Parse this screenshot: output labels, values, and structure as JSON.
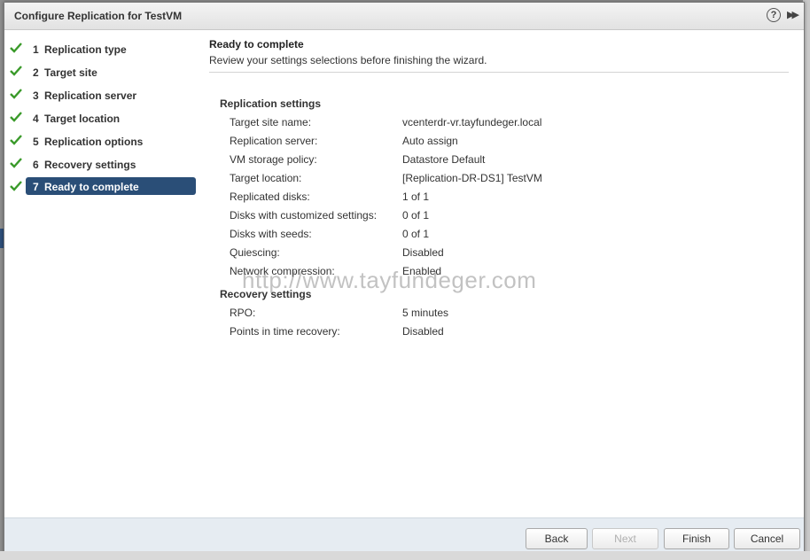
{
  "window": {
    "title": "Configure Replication for TestVM"
  },
  "steps": [
    {
      "num": "1",
      "label": "Replication type",
      "done": true
    },
    {
      "num": "2",
      "label": "Target site",
      "done": true
    },
    {
      "num": "3",
      "label": "Replication server",
      "done": true
    },
    {
      "num": "4",
      "label": "Target location",
      "done": true
    },
    {
      "num": "5",
      "label": "Replication options",
      "done": true
    },
    {
      "num": "6",
      "label": "Recovery settings",
      "done": true
    },
    {
      "num": "7",
      "label": "Ready to complete",
      "done": true,
      "active": true
    }
  ],
  "content": {
    "title": "Ready to complete",
    "subtitle": "Review your settings selections before finishing the wizard.",
    "replication_title": "Replication settings",
    "replication": [
      {
        "label": "Target site name:",
        "value": "vcenterdr-vr.tayfundeger.local"
      },
      {
        "label": "Replication server:",
        "value": "Auto assign"
      },
      {
        "label": "VM storage policy:",
        "value": "Datastore Default"
      },
      {
        "label": "Target location:",
        "value": "[Replication-DR-DS1] TestVM"
      },
      {
        "label": "Replicated disks:",
        "value": "1 of 1"
      },
      {
        "label": "Disks with customized settings:",
        "value": "0 of 1"
      },
      {
        "label": "Disks with seeds:",
        "value": "0 of 1"
      },
      {
        "label": "Quiescing:",
        "value": "Disabled"
      },
      {
        "label": "Network compression:",
        "value": "Enabled"
      }
    ],
    "recovery_title": "Recovery settings",
    "recovery": [
      {
        "label": "RPO:",
        "value": "5 minutes"
      },
      {
        "label": "Points in time recovery:",
        "value": "Disabled"
      }
    ]
  },
  "watermark": "http://www.tayfundeger.com",
  "buttons": {
    "back": "Back",
    "next": "Next",
    "finish": "Finish",
    "cancel": "Cancel"
  },
  "colors": {
    "active_step": "#2a4e77",
    "check": "#3a9a2a",
    "footer": "#e6ecf2"
  }
}
